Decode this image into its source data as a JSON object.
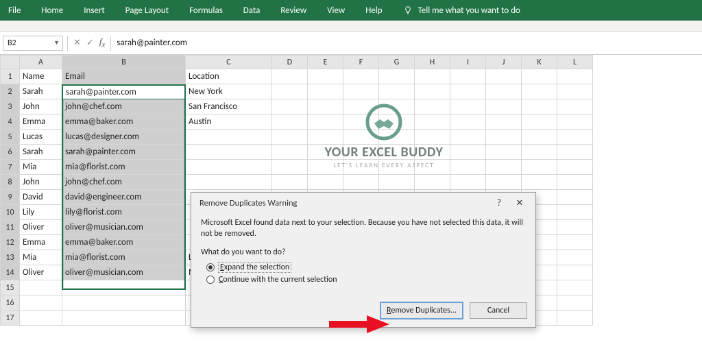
{
  "ribbon": {
    "tabs": [
      "File",
      "Home",
      "Insert",
      "Page Layout",
      "Formulas",
      "Data",
      "Review",
      "View",
      "Help"
    ],
    "tell_me": "Tell me what you want to do"
  },
  "formula_bar": {
    "name_box": "B2",
    "value": "sarah@painter.com"
  },
  "columns": [
    "A",
    "B",
    "C",
    "D",
    "E",
    "F",
    "G",
    "H",
    "I",
    "J",
    "K",
    "L"
  ],
  "headers": {
    "name": "Name",
    "email": "Email",
    "location": "Location"
  },
  "rows": [
    {
      "name": "Sarah",
      "email": "sarah@painter.com",
      "location": "New York"
    },
    {
      "name": "John",
      "email": "john@chef.com",
      "location": "San Francisco"
    },
    {
      "name": "Emma",
      "email": "emma@baker.com",
      "location": "Austin"
    },
    {
      "name": "Lucas",
      "email": "lucas@designer.com",
      "location": ""
    },
    {
      "name": "Sarah",
      "email": "sarah@painter.com",
      "location": ""
    },
    {
      "name": "Mia",
      "email": "mia@florist.com",
      "location": ""
    },
    {
      "name": "John",
      "email": "john@chef.com",
      "location": ""
    },
    {
      "name": "David",
      "email": "david@engineer.com",
      "location": ""
    },
    {
      "name": "Lily",
      "email": "lily@florist.com",
      "location": ""
    },
    {
      "name": "Oliver",
      "email": "oliver@musician.com",
      "location": ""
    },
    {
      "name": "Emma",
      "email": "emma@baker.com",
      "location": ""
    },
    {
      "name": "Mia",
      "email": "mia@florist.com",
      "location": "Los Angeles"
    },
    {
      "name": "Oliver",
      "email": "oliver@musician.com",
      "location": "Miami"
    }
  ],
  "empty_rows": [
    "15",
    "16",
    "17"
  ],
  "dialog": {
    "title": "Remove Duplicates Warning",
    "msg": "Microsoft Excel found data next to your selection. Because you have not selected this data, it will not be removed.",
    "question": "What do you want to do?",
    "opt1_pre": "",
    "opt1_mn": "E",
    "opt1_post": "xpand the selection",
    "opt2_pre": "",
    "opt2_mn": "C",
    "opt2_post": "ontinue with the current selection",
    "btn_primary_mn": "R",
    "btn_primary_post": "emove Duplicates...",
    "btn_cancel": "Cancel",
    "help": "?",
    "close": "✕"
  },
  "watermark": {
    "line1": "YOUR EXCEL BUDDY",
    "line2": "LET'S LEARN EVERY ASPECT"
  }
}
